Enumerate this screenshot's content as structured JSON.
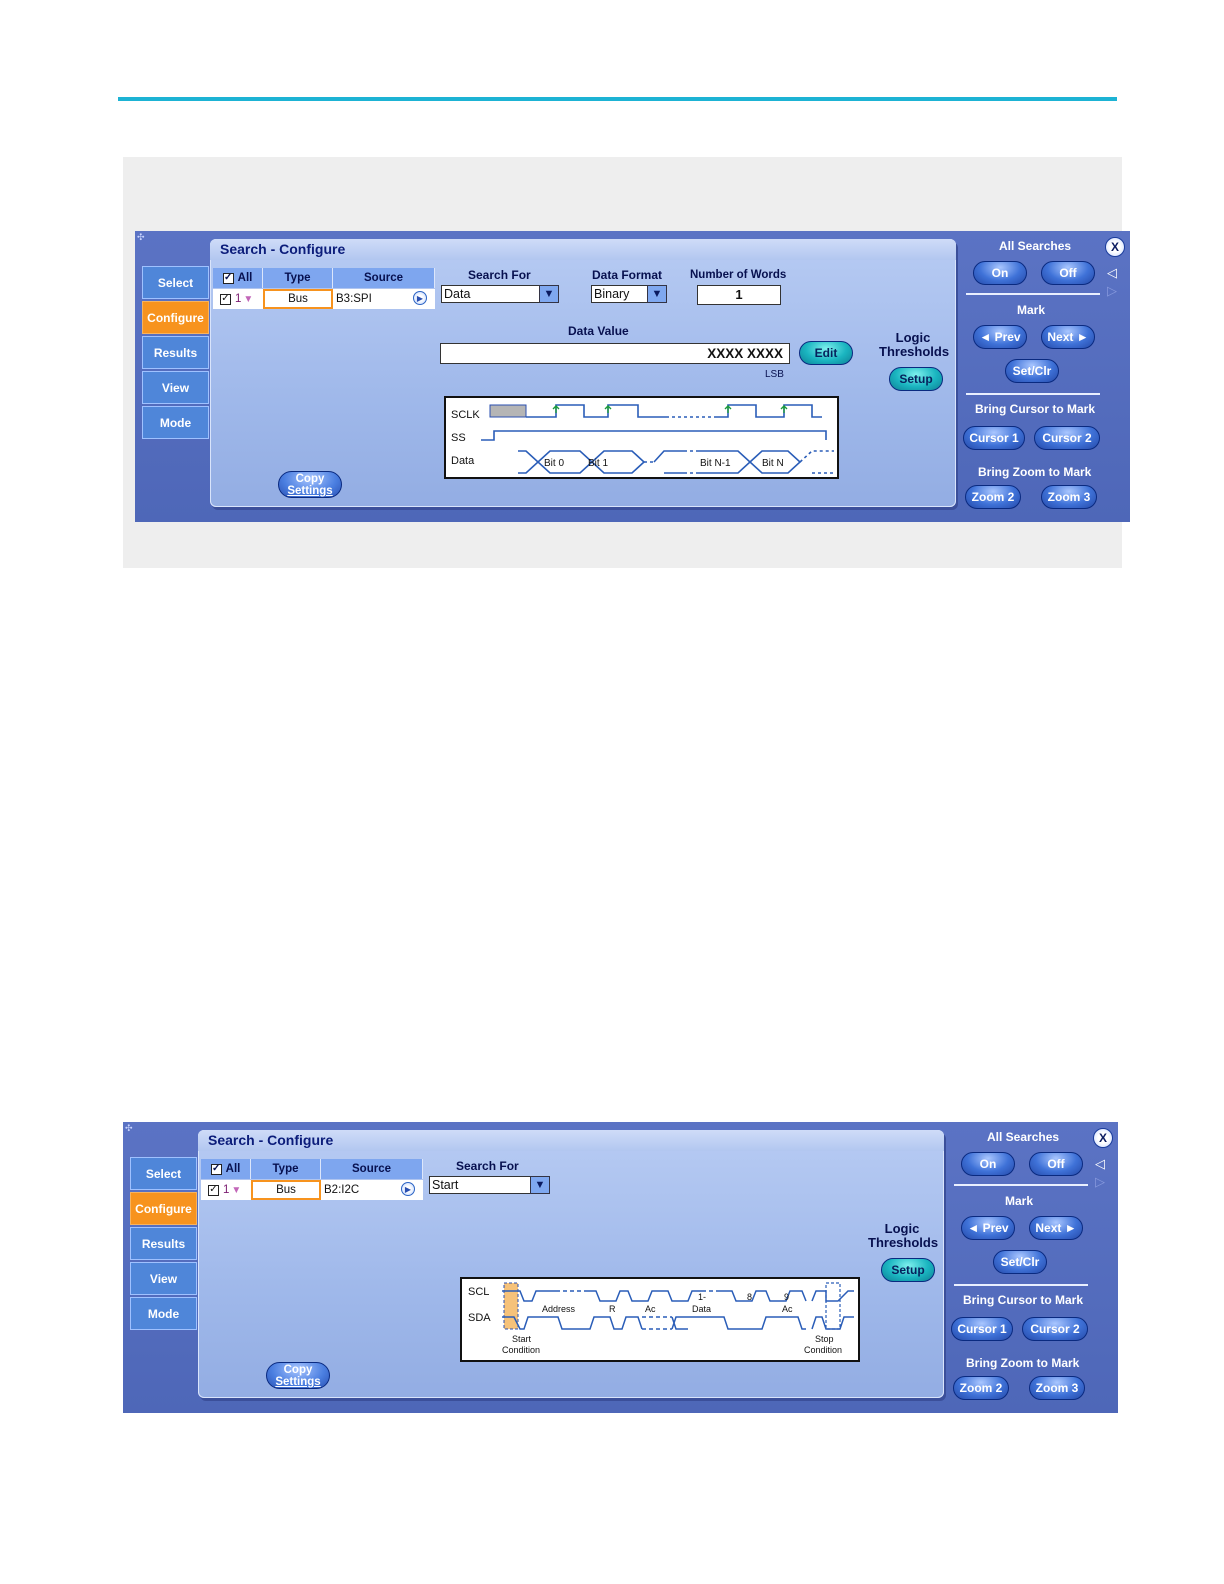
{
  "screens": [
    {
      "window_title": "Search - Configure",
      "tabs": [
        "Select",
        "Configure",
        "Results",
        "View",
        "Mode"
      ],
      "active_tab": "Configure",
      "table": {
        "headers": {
          "all": "All",
          "type": "Type",
          "source": "Source"
        },
        "row": {
          "index": "1",
          "type": "Bus",
          "source": "B3:SPI"
        }
      },
      "search_for": {
        "label": "Search For",
        "value": "Data"
      },
      "data_format": {
        "label": "Data Format",
        "value": "Binary"
      },
      "number_of_words": {
        "label": "Number of Words",
        "value": "1"
      },
      "data_value": {
        "label": "Data Value",
        "value": "XXXX XXXX",
        "lsb": "LSB",
        "edit": "Edit"
      },
      "logic_thresholds": {
        "line1": "Logic",
        "line2": "Thresholds",
        "button": "Setup"
      },
      "copy_settings": {
        "line1": "Copy",
        "line2": "Settings"
      },
      "diagram": {
        "signals": [
          "SCLK",
          "SS",
          "Data"
        ],
        "bits": [
          "Bit 0",
          "Bit 1",
          "Bit N-1",
          "Bit N"
        ]
      }
    },
    {
      "window_title": "Search - Configure",
      "tabs": [
        "Select",
        "Configure",
        "Results",
        "View",
        "Mode"
      ],
      "active_tab": "Configure",
      "table": {
        "headers": {
          "all": "All",
          "type": "Type",
          "source": "Source"
        },
        "row": {
          "index": "1",
          "type": "Bus",
          "source": "B2:I2C"
        }
      },
      "search_for": {
        "label": "Search For",
        "value": "Start"
      },
      "logic_thresholds": {
        "line1": "Logic",
        "line2": "Thresholds",
        "button": "Setup"
      },
      "copy_settings": {
        "line1": "Copy",
        "line2": "Settings"
      },
      "diagram": {
        "signals": [
          "SCL",
          "SDA"
        ],
        "fields": [
          "Address",
          "R",
          "Ac",
          "Data",
          "Ac"
        ],
        "numbers": [
          "1-",
          "8",
          "9"
        ],
        "start": [
          "Start",
          "Condition"
        ],
        "stop": [
          "Stop",
          "Condition"
        ]
      }
    }
  ],
  "right_panel": {
    "all_searches": "All Searches",
    "on": "On",
    "off": "Off",
    "mark": "Mark",
    "prev": "◄ Prev",
    "next": "Next ►",
    "setclr": "Set/Clr",
    "bring_cursor": "Bring Cursor to Mark",
    "cursor1": "Cursor 1",
    "cursor2": "Cursor 2",
    "bring_zoom": "Bring Zoom to Mark",
    "zoom2": "Zoom 2",
    "zoom3": "Zoom 3",
    "close": "X"
  },
  "colors": {
    "accent_line": "#1db3d4",
    "active_tab": "#f7931e",
    "panel": "#5b73c4"
  }
}
